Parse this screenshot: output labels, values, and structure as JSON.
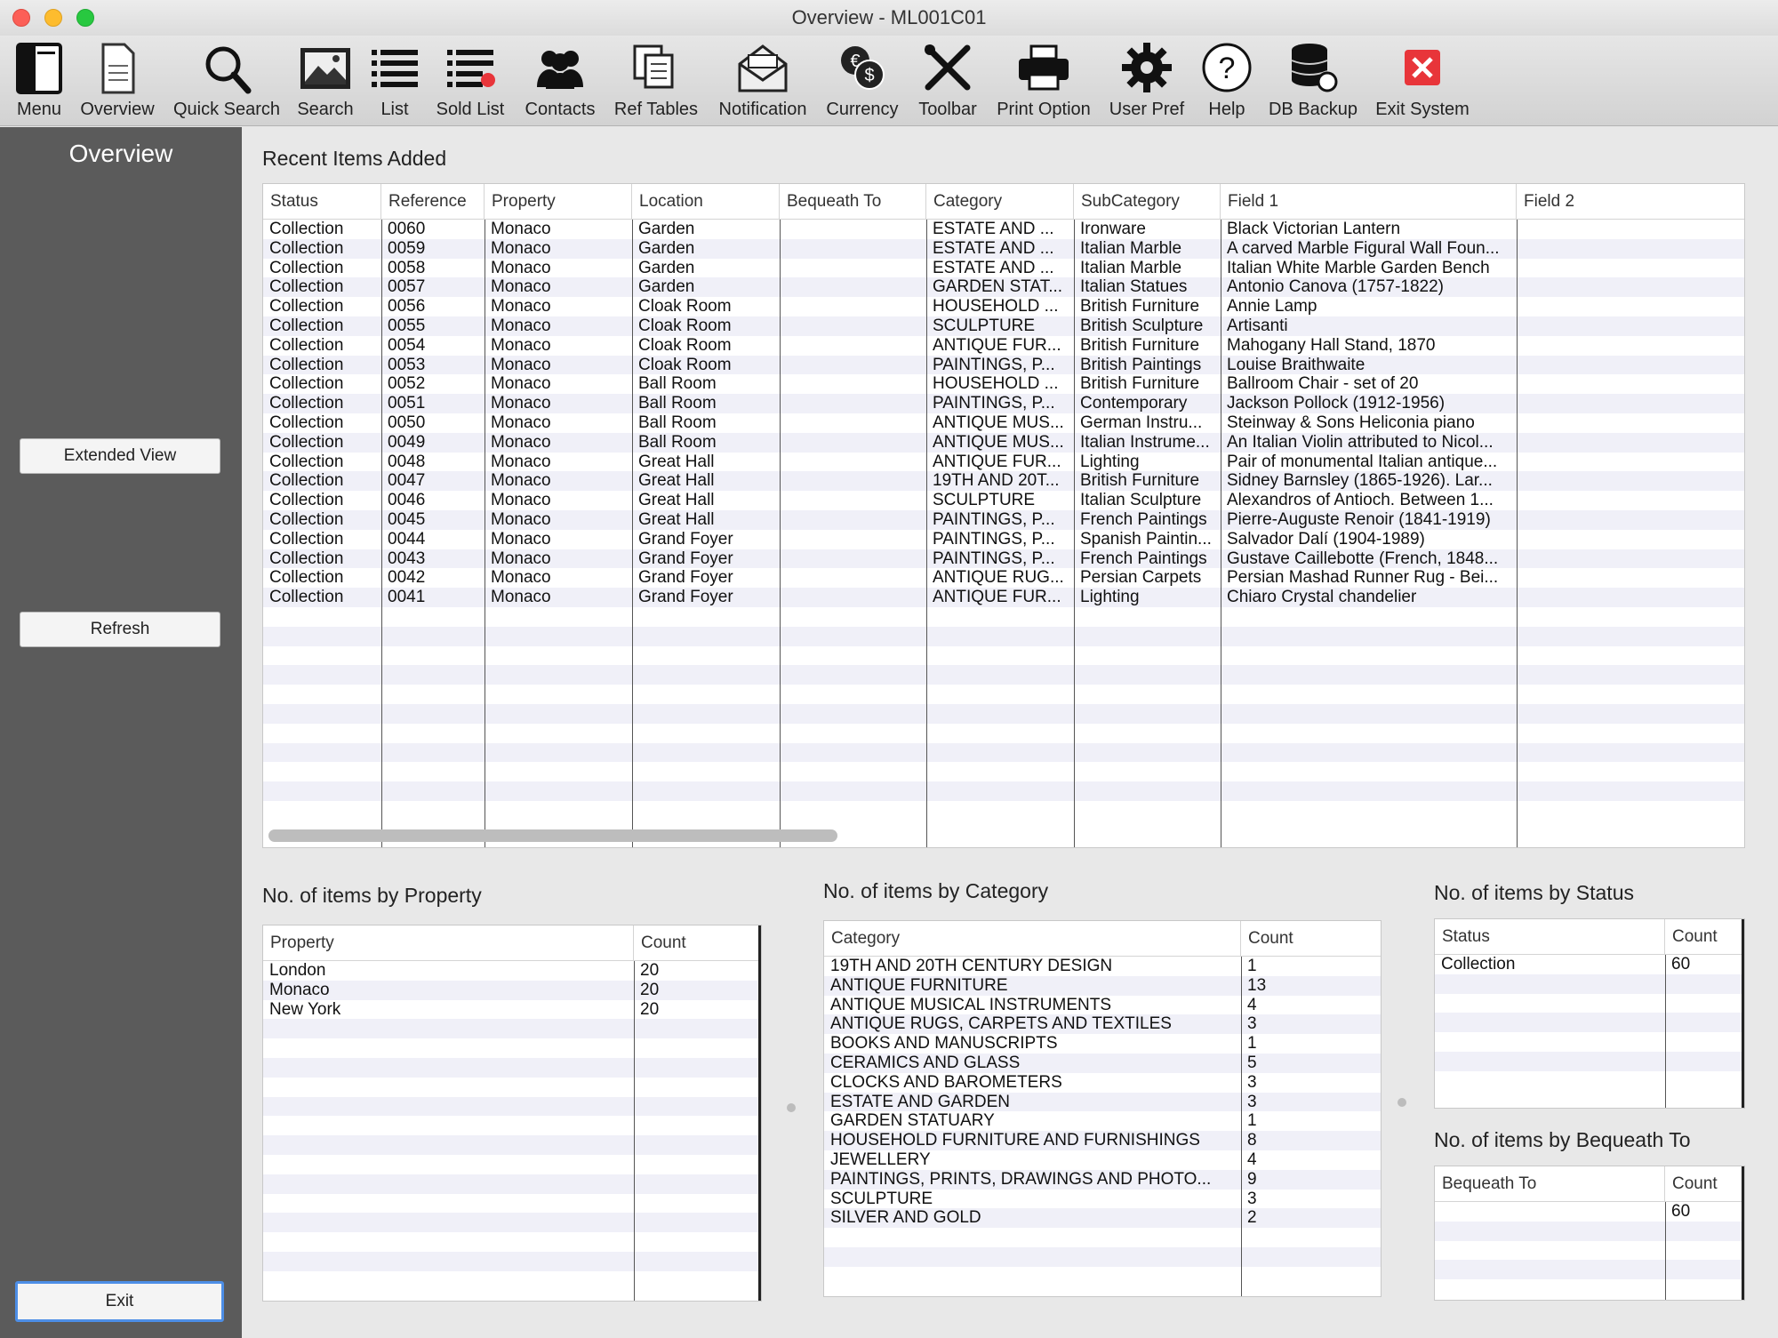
{
  "window": {
    "title": "Overview - ML001C01"
  },
  "toolbar": [
    {
      "label": "Menu",
      "icon": "menu-book-icon"
    },
    {
      "label": "Overview",
      "icon": "document-icon"
    },
    {
      "label": "Quick Search",
      "icon": "magnifier-icon"
    },
    {
      "label": "Search",
      "icon": "picture-icon"
    },
    {
      "label": "List",
      "icon": "list-icon"
    },
    {
      "label": "Sold List",
      "icon": "sold-list-icon"
    },
    {
      "label": "Contacts",
      "icon": "people-icon"
    },
    {
      "label": "Ref Tables",
      "icon": "tables-icon"
    },
    {
      "label": "Notification",
      "icon": "envelope-icon"
    },
    {
      "label": "Currency",
      "icon": "currency-icon"
    },
    {
      "label": "Toolbar",
      "icon": "tools-icon"
    },
    {
      "label": "Print Option",
      "icon": "printer-icon"
    },
    {
      "label": "User Pref",
      "icon": "gear-icon"
    },
    {
      "label": "Help",
      "icon": "help-icon"
    },
    {
      "label": "DB Backup",
      "icon": "database-icon"
    },
    {
      "label": "Exit System",
      "icon": "exit-icon"
    }
  ],
  "sidebar": {
    "title": "Overview",
    "extended_view": "Extended View",
    "refresh": "Refresh",
    "exit": "Exit"
  },
  "recent": {
    "label": "Recent Items Added",
    "columns": [
      "Status",
      "Reference",
      "Property",
      "Location",
      "Bequeath To",
      "Category",
      "SubCategory",
      "Field 1",
      "Field 2"
    ],
    "rows": [
      [
        "Collection",
        "0060",
        "Monaco",
        "Garden",
        "",
        "ESTATE AND ...",
        "Ironware",
        "Black Victorian Lantern",
        ""
      ],
      [
        "Collection",
        "0059",
        "Monaco",
        "Garden",
        "",
        "ESTATE AND ...",
        "Italian Marble",
        "A carved Marble Figural Wall Foun...",
        ""
      ],
      [
        "Collection",
        "0058",
        "Monaco",
        "Garden",
        "",
        "ESTATE AND ...",
        "Italian Marble",
        "Italian White Marble Garden Bench",
        ""
      ],
      [
        "Collection",
        "0057",
        "Monaco",
        "Garden",
        "",
        "GARDEN STAT...",
        "Italian Statues",
        "Antonio Canova (1757-1822)",
        ""
      ],
      [
        "Collection",
        "0056",
        "Monaco",
        "Cloak Room",
        "",
        "HOUSEHOLD ...",
        "British Furniture",
        "Annie Lamp",
        ""
      ],
      [
        "Collection",
        "0055",
        "Monaco",
        "Cloak Room",
        "",
        "SCULPTURE",
        "British Sculpture",
        "Artisanti",
        ""
      ],
      [
        "Collection",
        "0054",
        "Monaco",
        "Cloak Room",
        "",
        "ANTIQUE FUR...",
        "British Furniture",
        "Mahogany Hall Stand, 1870",
        ""
      ],
      [
        "Collection",
        "0053",
        "Monaco",
        "Cloak Room",
        "",
        "PAINTINGS, P...",
        "British Paintings",
        "Louise Braithwaite",
        ""
      ],
      [
        "Collection",
        "0052",
        "Monaco",
        "Ball Room",
        "",
        "HOUSEHOLD ...",
        "British Furniture",
        "Ballroom Chair - set of 20",
        ""
      ],
      [
        "Collection",
        "0051",
        "Monaco",
        "Ball Room",
        "",
        "PAINTINGS, P...",
        "Contemporary",
        "Jackson Pollock (1912-1956)",
        ""
      ],
      [
        "Collection",
        "0050",
        "Monaco",
        "Ball Room",
        "",
        "ANTIQUE MUS...",
        "German Instru...",
        "Steinway & Sons Heliconia piano",
        ""
      ],
      [
        "Collection",
        "0049",
        "Monaco",
        "Ball Room",
        "",
        "ANTIQUE MUS...",
        "Italian Instrume...",
        "An Italian Violin attributed to Nicol...",
        ""
      ],
      [
        "Collection",
        "0048",
        "Monaco",
        "Great Hall",
        "",
        "ANTIQUE FUR...",
        "Lighting",
        "Pair of monumental Italian antique...",
        ""
      ],
      [
        "Collection",
        "0047",
        "Monaco",
        "Great Hall",
        "",
        "19TH AND 20T...",
        "British Furniture",
        "Sidney Barnsley (1865-1926). Lar...",
        ""
      ],
      [
        "Collection",
        "0046",
        "Monaco",
        "Great Hall",
        "",
        "SCULPTURE",
        "Italian Sculpture",
        "Alexandros of Antioch. Between 1...",
        ""
      ],
      [
        "Collection",
        "0045",
        "Monaco",
        "Great Hall",
        "",
        "PAINTINGS, P...",
        "French Paintings",
        "Pierre-Auguste Renoir (1841-1919)",
        ""
      ],
      [
        "Collection",
        "0044",
        "Monaco",
        "Grand Foyer",
        "",
        "PAINTINGS, P...",
        "Spanish Paintin...",
        "Salvador Dalí (1904-1989)",
        ""
      ],
      [
        "Collection",
        "0043",
        "Monaco",
        "Grand Foyer",
        "",
        "PAINTINGS, P...",
        "French Paintings",
        "Gustave Caillebotte (French, 1848...",
        ""
      ],
      [
        "Collection",
        "0042",
        "Monaco",
        "Grand Foyer",
        "",
        "ANTIQUE RUG...",
        "Persian Carpets",
        "Persian Mashad Runner Rug - Bei...",
        ""
      ],
      [
        "Collection",
        "0041",
        "Monaco",
        "Grand Foyer",
        "",
        "ANTIQUE FUR...",
        "Lighting",
        "Chiaro Crystal chandelier",
        ""
      ]
    ]
  },
  "by_property": {
    "label": "No. of items by Property",
    "columns": [
      "Property",
      "Count"
    ],
    "rows": [
      [
        "London",
        "20"
      ],
      [
        "Monaco",
        "20"
      ],
      [
        "New York",
        "20"
      ]
    ]
  },
  "by_category": {
    "label": "No. of items by Category",
    "columns": [
      "Category",
      "Count"
    ],
    "rows": [
      [
        "19TH AND 20TH CENTURY DESIGN",
        "1"
      ],
      [
        "ANTIQUE FURNITURE",
        "13"
      ],
      [
        "ANTIQUE MUSICAL INSTRUMENTS",
        "4"
      ],
      [
        "ANTIQUE RUGS, CARPETS AND TEXTILES",
        "3"
      ],
      [
        "BOOKS AND MANUSCRIPTS",
        "1"
      ],
      [
        "CERAMICS AND GLASS",
        "5"
      ],
      [
        "CLOCKS AND BAROMETERS",
        "3"
      ],
      [
        "ESTATE AND GARDEN",
        "3"
      ],
      [
        "GARDEN STATUARY",
        "1"
      ],
      [
        "HOUSEHOLD FURNITURE AND FURNISHINGS",
        "8"
      ],
      [
        "JEWELLERY",
        "4"
      ],
      [
        "PAINTINGS, PRINTS, DRAWINGS AND PHOTO...",
        "9"
      ],
      [
        "SCULPTURE",
        "3"
      ],
      [
        "SILVER AND GOLD",
        "2"
      ]
    ]
  },
  "by_status": {
    "label": "No. of items by Status",
    "columns": [
      "Status",
      "Count"
    ],
    "rows": [
      [
        "Collection",
        "60"
      ]
    ]
  },
  "by_bequeath": {
    "label": "No. of items by Bequeath To",
    "columns": [
      "Bequeath To",
      "Count"
    ],
    "rows": [
      [
        "",
        "60"
      ]
    ]
  },
  "colors": {
    "sidebar": "#5b5b5b",
    "row_alt": "#f0f0f8",
    "exit_red": "#e8353a",
    "focus_blue": "#4d8ee6"
  }
}
